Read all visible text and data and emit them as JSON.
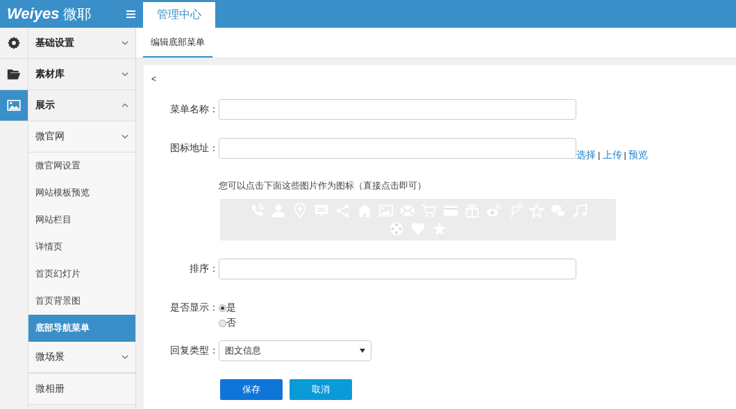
{
  "logo": {
    "wordmark": "Weiyes",
    "name": "微耶"
  },
  "top_tabs": [
    {
      "label": "管理中心",
      "selected": true
    }
  ],
  "sub_tabs": [
    {
      "label": "编辑底部菜单",
      "selected": true
    }
  ],
  "sidebar": {
    "sections": [
      {
        "label": "基础设置",
        "expanded": false,
        "selected": false
      },
      {
        "label": "素材库",
        "expanded": false,
        "selected": false
      },
      {
        "label": "展示",
        "expanded": true,
        "selected": true,
        "children": [
          {
            "label": "微官网",
            "kind": "group",
            "expanded": false
          },
          {
            "label": "微官网设置",
            "kind": "link",
            "selected": false
          },
          {
            "label": "网站模板预览",
            "kind": "link",
            "selected": false
          },
          {
            "label": "网站栏目",
            "kind": "link",
            "selected": false
          },
          {
            "label": "详情页",
            "kind": "link",
            "selected": false
          },
          {
            "label": "首页幻灯片",
            "kind": "link",
            "selected": false
          },
          {
            "label": "首页背景图",
            "kind": "link",
            "selected": false
          },
          {
            "label": "底部导航菜单",
            "kind": "link",
            "selected": true
          },
          {
            "label": "微场景",
            "kind": "group",
            "expanded": false
          },
          {
            "label": "微相册",
            "kind": "link",
            "selected": false
          }
        ]
      }
    ]
  },
  "back": "<",
  "form": {
    "rows": [
      {
        "kind": "text",
        "label": "菜单名称：",
        "value": ""
      },
      {
        "kind": "text",
        "label": "图标地址：",
        "value": "",
        "links": [
          "选择",
          "上传",
          "预览"
        ],
        "separator": "|"
      },
      {
        "kind": "icons",
        "hint": "您可以点击下面这些图片作为图标（直接点击即可）"
      },
      {
        "kind": "text",
        "label": "排序：",
        "value": ""
      },
      {
        "kind": "radio",
        "label": "是否显示：",
        "options": [
          {
            "label": "是",
            "selected": true
          },
          {
            "label": "否",
            "selected": false
          }
        ]
      },
      {
        "kind": "select",
        "label": "回复类型：",
        "value": "图文信息"
      }
    ],
    "buttons": [
      {
        "label": "保存",
        "kind": "primary"
      },
      {
        "label": "取消",
        "kind": "secondary"
      }
    ]
  }
}
